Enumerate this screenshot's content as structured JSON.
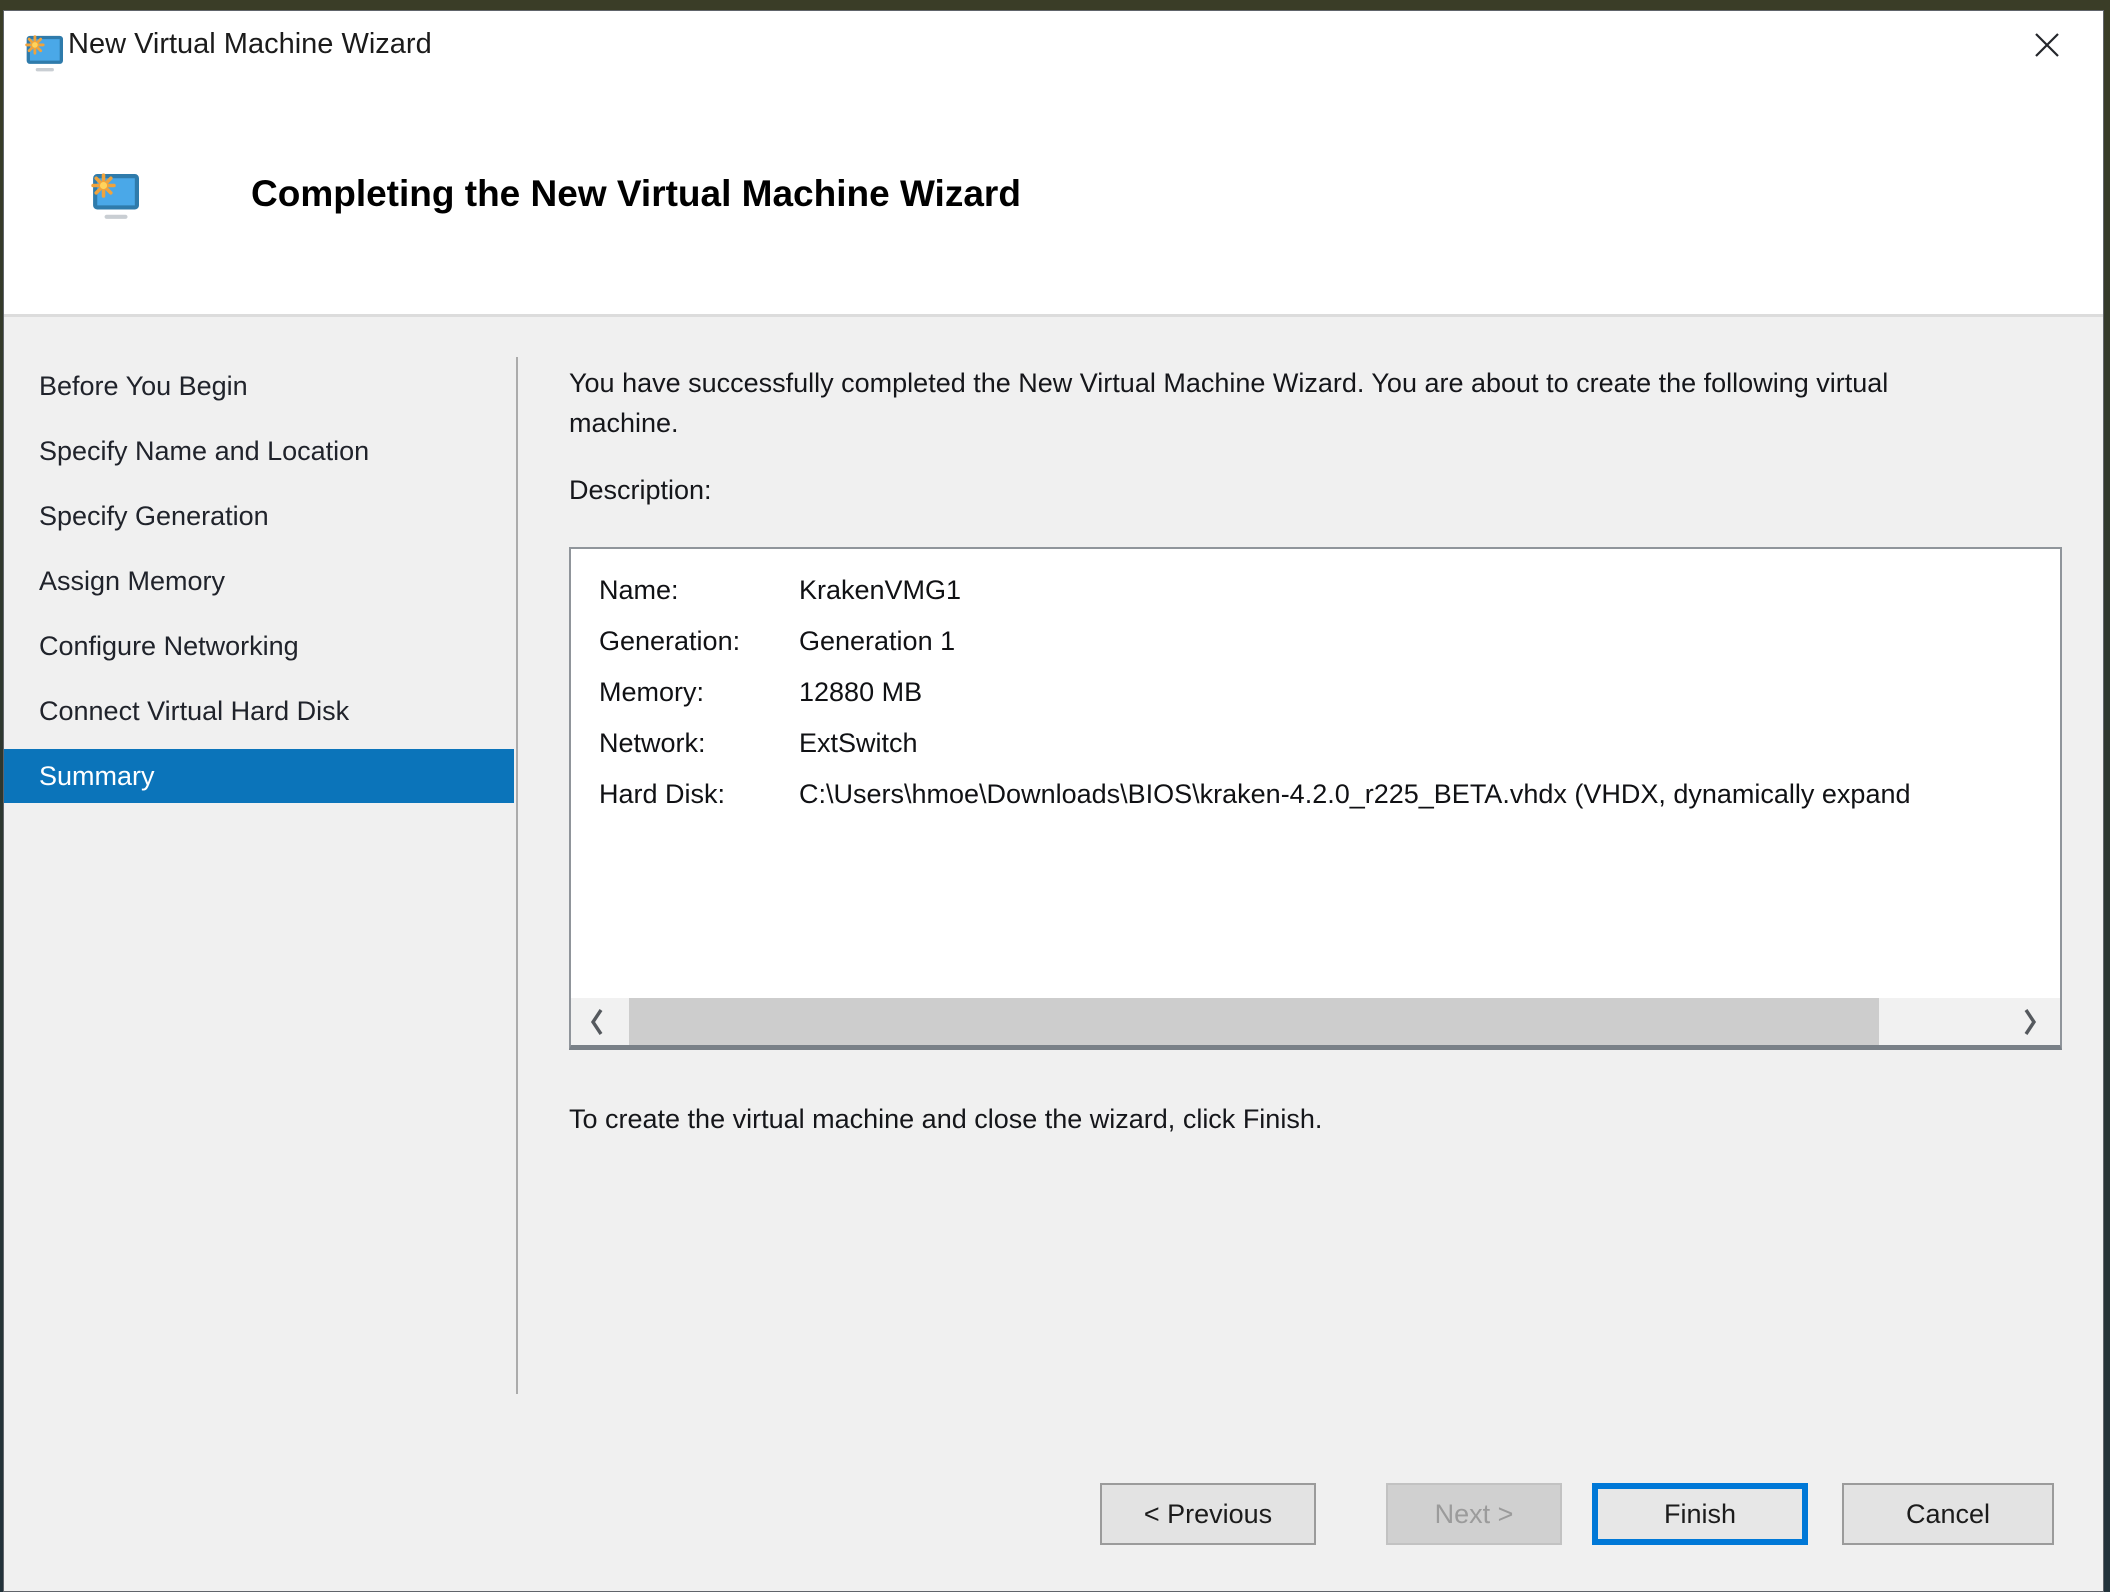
{
  "window": {
    "title": "New Virtual Machine Wizard"
  },
  "header": {
    "title": "Completing the New Virtual Machine Wizard"
  },
  "sidebar": {
    "items": [
      {
        "label": "Before You Begin",
        "selected": false
      },
      {
        "label": "Specify Name and Location",
        "selected": false
      },
      {
        "label": "Specify Generation",
        "selected": false
      },
      {
        "label": "Assign Memory",
        "selected": false
      },
      {
        "label": "Configure Networking",
        "selected": false
      },
      {
        "label": "Connect Virtual Hard Disk",
        "selected": false
      },
      {
        "label": "Summary",
        "selected": true
      }
    ]
  },
  "main": {
    "intro": "You have successfully completed the New Virtual Machine Wizard. You are about to create the following virtual machine.",
    "description_label": "Description:",
    "summary": {
      "rows": [
        {
          "label": "Name:",
          "value": "KrakenVMG1"
        },
        {
          "label": "Generation:",
          "value": "Generation 1"
        },
        {
          "label": "Memory:",
          "value": "12880 MB"
        },
        {
          "label": "Network:",
          "value": "ExtSwitch"
        },
        {
          "label": "Hard Disk:",
          "value": "C:\\Users\\hmoe\\Downloads\\BIOS\\kraken-4.2.0_r225_BETA.vhdx (VHDX, dynamically expand"
        }
      ]
    },
    "footer_hint": "To create the virtual machine and close the wizard, click Finish."
  },
  "buttons": {
    "previous": "< Previous",
    "next": "Next >",
    "finish": "Finish",
    "cancel": "Cancel"
  },
  "icons": {
    "app": "monitor-with-sparkle",
    "close": "x-mark",
    "scroll_left": "chevron-left",
    "scroll_right": "chevron-right"
  },
  "colors": {
    "selection_blue": "#0b74ba",
    "focus_blue": "#0078d7",
    "body_gray": "#f0f0f0"
  }
}
